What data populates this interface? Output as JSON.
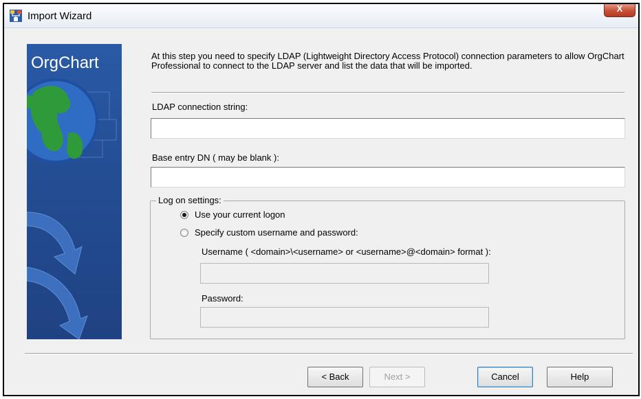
{
  "window": {
    "title": "Import Wizard",
    "close_label": "X"
  },
  "side_panel": {
    "logo_text": "OrgChart"
  },
  "intro_text": "At this step you need to specify LDAP (Lightweight Directory Access Protocol) connection parameters to allow OrgChart Professional to connect to the LDAP server and list the data that will be imported.",
  "ldap": {
    "label": "LDAP connection string:",
    "value": ""
  },
  "base_dn": {
    "label": "Base entry DN ( may be blank ):",
    "value": ""
  },
  "logon": {
    "group_label": "Log on settings:",
    "option_current": "Use your current logon",
    "option_custom": "Specify custom username and password:",
    "selected": "current",
    "username_label": "Username ( <domain>\\<username> or <username>@<domain> format ):",
    "username_value": "",
    "password_label": "Password:",
    "password_value": ""
  },
  "buttons": {
    "back": "< Back",
    "next": "Next >",
    "cancel": "Cancel",
    "help": "Help"
  }
}
